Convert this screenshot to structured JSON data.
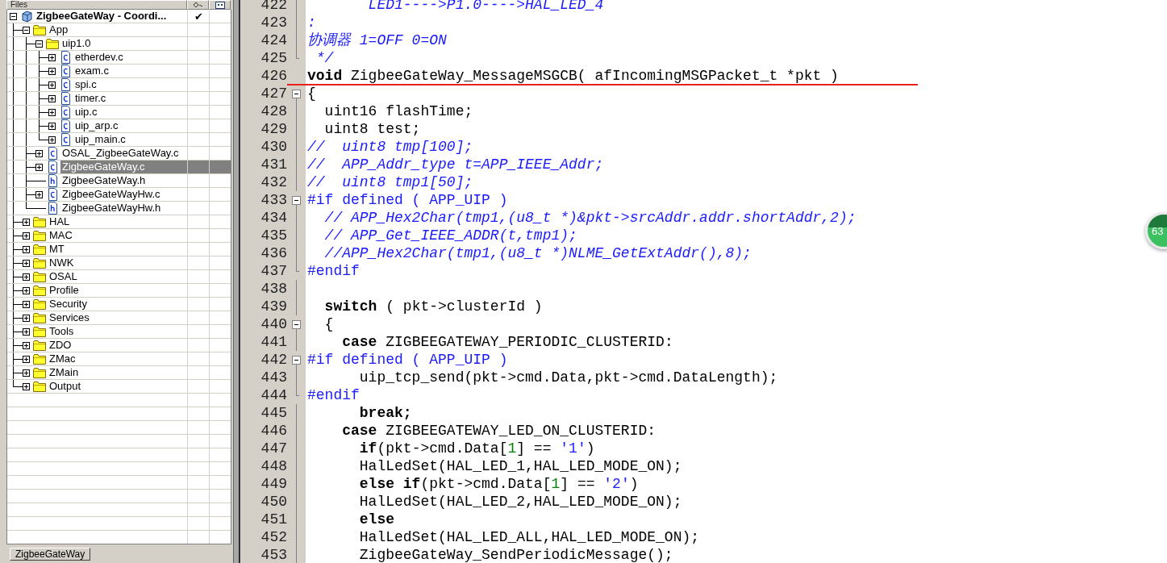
{
  "panel": {
    "header": {
      "title": "Files"
    },
    "tree": {
      "items": [
        {
          "label": "ZigbeeGateWay - Coordi...",
          "kind": "project",
          "expanded": true,
          "selected": false,
          "column_2": "✔",
          "children": [
            {
              "label": "App",
              "kind": "folder",
              "expanded": true,
              "selected": false,
              "children": [
                {
                  "label": "uip1.0",
                  "kind": "folder",
                  "expanded": true,
                  "selected": false,
                  "children": [
                    {
                      "label": "etherdev.c",
                      "kind": "c",
                      "expanded": false,
                      "selected": false
                    },
                    {
                      "label": "exam.c",
                      "kind": "c",
                      "expanded": false,
                      "selected": false
                    },
                    {
                      "label": "spi.c",
                      "kind": "c",
                      "expanded": false,
                      "selected": false
                    },
                    {
                      "label": "timer.c",
                      "kind": "c",
                      "expanded": false,
                      "selected": false
                    },
                    {
                      "label": "uip.c",
                      "kind": "c",
                      "expanded": false,
                      "selected": false
                    },
                    {
                      "label": "uip_arp.c",
                      "kind": "c",
                      "expanded": false,
                      "selected": false
                    },
                    {
                      "label": "uip_main.c",
                      "kind": "c",
                      "expanded": false,
                      "selected": false
                    }
                  ]
                },
                {
                  "label": "OSAL_ZigbeeGateWay.c",
                  "kind": "c",
                  "expanded": false,
                  "selected": false
                },
                {
                  "label": "ZigbeeGateWay.c",
                  "kind": "c",
                  "expanded": false,
                  "selected": true
                },
                {
                  "label": "ZigbeeGateWay.h",
                  "kind": "h",
                  "selected": false
                },
                {
                  "label": "ZigbeeGateWayHw.c",
                  "kind": "c",
                  "expanded": false,
                  "selected": false
                },
                {
                  "label": "ZigbeeGateWayHw.h",
                  "kind": "h",
                  "selected": false
                }
              ]
            },
            {
              "label": "HAL",
              "kind": "folder",
              "expanded": false,
              "selected": false
            },
            {
              "label": "MAC",
              "kind": "folder",
              "expanded": false,
              "selected": false
            },
            {
              "label": "MT",
              "kind": "folder",
              "expanded": false,
              "selected": false
            },
            {
              "label": "NWK",
              "kind": "folder",
              "expanded": false,
              "selected": false
            },
            {
              "label": "OSAL",
              "kind": "folder",
              "expanded": false,
              "selected": false
            },
            {
              "label": "Profile",
              "kind": "folder",
              "expanded": false,
              "selected": false
            },
            {
              "label": "Security",
              "kind": "folder",
              "expanded": false,
              "selected": false
            },
            {
              "label": "Services",
              "kind": "folder",
              "expanded": false,
              "selected": false
            },
            {
              "label": "Tools",
              "kind": "folder",
              "expanded": false,
              "selected": false
            },
            {
              "label": "ZDO",
              "kind": "folder",
              "expanded": false,
              "selected": false
            },
            {
              "label": "ZMac",
              "kind": "folder",
              "expanded": false,
              "selected": false
            },
            {
              "label": "ZMain",
              "kind": "folder",
              "expanded": false,
              "selected": false
            },
            {
              "label": "Output",
              "kind": "folder",
              "expanded": false,
              "selected": false
            }
          ]
        }
      ]
    },
    "tab": {
      "label": "ZigbeeGateWay"
    }
  },
  "editor": {
    "lines": [
      {
        "number": "422",
        "kind": "inner",
        "tokens": [
          {
            "kind": "comment",
            "text": "       LED1---->P1.0---->HAL_LED_4"
          }
        ]
      },
      {
        "number": "423",
        "kind": "inner",
        "tokens": [
          {
            "kind": "comment",
            "text": ":"
          }
        ]
      },
      {
        "number": "424",
        "kind": "inner",
        "tokens": [
          {
            "kind": "comment",
            "text": "协调器 1=OFF 0=ON"
          }
        ]
      },
      {
        "number": "425",
        "kind": "closer",
        "tokens": [
          {
            "kind": "comment",
            "text": " */"
          }
        ]
      },
      {
        "number": "426",
        "kind": "outer",
        "underlined": true,
        "tokens": [
          {
            "kind": "keyword",
            "text": "void"
          },
          {
            "kind": "plain",
            "text": " ZigbeeGateWay_MessageMSGCB( afIncomingMSGPacket_t *pkt )"
          }
        ]
      },
      {
        "number": "427",
        "kind": "opener",
        "tokens": [
          {
            "kind": "plain",
            "text": "{"
          }
        ]
      },
      {
        "number": "428",
        "kind": "inner",
        "tokens": [
          {
            "kind": "plain",
            "text": "  uint16 flashTime;"
          }
        ]
      },
      {
        "number": "429",
        "kind": "inner",
        "tokens": [
          {
            "kind": "plain",
            "text": "  uint8 test;"
          }
        ]
      },
      {
        "number": "430",
        "kind": "inner",
        "tokens": [
          {
            "kind": "comment",
            "text": "//  uint8 tmp[100];"
          }
        ]
      },
      {
        "number": "431",
        "kind": "inner",
        "tokens": [
          {
            "kind": "comment",
            "text": "//  APP_Addr_type t=APP_IEEE_Addr;"
          }
        ]
      },
      {
        "number": "432",
        "kind": "inner",
        "tokens": [
          {
            "kind": "comment",
            "text": "//  uint8 tmp1[50];"
          }
        ]
      },
      {
        "number": "433",
        "kind": "opener",
        "tokens": [
          {
            "kind": "directive",
            "text": "#if defined ( APP_UIP )"
          }
        ]
      },
      {
        "number": "434",
        "kind": "inner",
        "tokens": [
          {
            "kind": "comment",
            "text": "  // APP_Hex2Char(tmp1,(u8_t *)&pkt->srcAddr.addr.shortAddr,2);"
          }
        ]
      },
      {
        "number": "435",
        "kind": "inner",
        "tokens": [
          {
            "kind": "comment",
            "text": "  // APP_Get_IEEE_ADDR(t,tmp1);"
          }
        ]
      },
      {
        "number": "436",
        "kind": "inner",
        "tokens": [
          {
            "kind": "comment",
            "text": "  //APP_Hex2Char(tmp1,(u8_t *)NLME_GetExtAddr(),8);"
          }
        ]
      },
      {
        "number": "437",
        "kind": "closer",
        "tokens": [
          {
            "kind": "directive",
            "text": "#endif"
          }
        ]
      },
      {
        "number": "438",
        "kind": "inner"
      },
      {
        "number": "439",
        "kind": "inner",
        "tokens": [
          {
            "kind": "keyword",
            "text": "  switch"
          },
          {
            "kind": "plain",
            "text": " ( pkt->clusterId )"
          }
        ]
      },
      {
        "number": "440",
        "kind": "opener",
        "tokens": [
          {
            "kind": "plain",
            "text": "  {"
          }
        ]
      },
      {
        "number": "441",
        "kind": "inner",
        "tokens": [
          {
            "kind": "keyword",
            "text": "    case"
          },
          {
            "kind": "plain",
            "text": " ZIGBEEGATEWAY_PERIODIC_CLUSTERID:"
          }
        ]
      },
      {
        "number": "442",
        "kind": "opener",
        "tokens": [
          {
            "kind": "directive",
            "text": "#if defined ( APP_UIP )"
          }
        ]
      },
      {
        "number": "443",
        "kind": "inner",
        "tokens": [
          {
            "kind": "plain",
            "text": "      uip_tcp_send(pkt->cmd.Data,pkt->cmd.DataLength);"
          }
        ]
      },
      {
        "number": "444",
        "kind": "closer",
        "tokens": [
          {
            "kind": "directive",
            "text": "#endif"
          }
        ]
      },
      {
        "number": "445",
        "kind": "inner",
        "tokens": [
          {
            "kind": "keyword",
            "text": "      break;"
          }
        ]
      },
      {
        "number": "446",
        "kind": "inner",
        "tokens": [
          {
            "kind": "keyword",
            "text": "    case"
          },
          {
            "kind": "plain",
            "text": " ZIGBEEGATEWAY_LED_ON_CLUSTERID:"
          }
        ]
      },
      {
        "number": "447",
        "kind": "inner",
        "tokens": [
          {
            "kind": "keyword",
            "text": "      if"
          },
          {
            "kind": "plain",
            "text": "(pkt->cmd.Data["
          },
          {
            "kind": "number",
            "text": "1"
          },
          {
            "kind": "plain",
            "text": "] == "
          },
          {
            "kind": "string",
            "text": "'1'"
          },
          {
            "kind": "plain",
            "text": ")"
          }
        ]
      },
      {
        "number": "448",
        "kind": "inner",
        "tokens": [
          {
            "kind": "plain",
            "text": "      HalLedSet(HAL_LED_1,HAL_LED_MODE_ON);"
          }
        ]
      },
      {
        "number": "449",
        "kind": "inner",
        "tokens": [
          {
            "kind": "keyword",
            "text": "      else if"
          },
          {
            "kind": "plain",
            "text": "(pkt->cmd.Data["
          },
          {
            "kind": "number",
            "text": "1"
          },
          {
            "kind": "plain",
            "text": "] == "
          },
          {
            "kind": "string",
            "text": "'2'"
          },
          {
            "kind": "plain",
            "text": ")"
          }
        ]
      },
      {
        "number": "450",
        "kind": "inner",
        "tokens": [
          {
            "kind": "plain",
            "text": "      HalLedSet(HAL_LED_2,HAL_LED_MODE_ON);"
          }
        ]
      },
      {
        "number": "451",
        "kind": "inner",
        "tokens": [
          {
            "kind": "keyword",
            "text": "      else"
          }
        ]
      },
      {
        "number": "452",
        "kind": "inner",
        "tokens": [
          {
            "kind": "plain",
            "text": "      HalLedSet(HAL_LED_ALL,HAL_LED_MODE_ON);"
          }
        ]
      },
      {
        "number": "453",
        "kind": "inner",
        "tokens": [
          {
            "kind": "plain",
            "text": "      ZigbeeGateWay_SendPeriodicMessage();"
          }
        ]
      }
    ]
  },
  "badge": {
    "count": "63"
  }
}
